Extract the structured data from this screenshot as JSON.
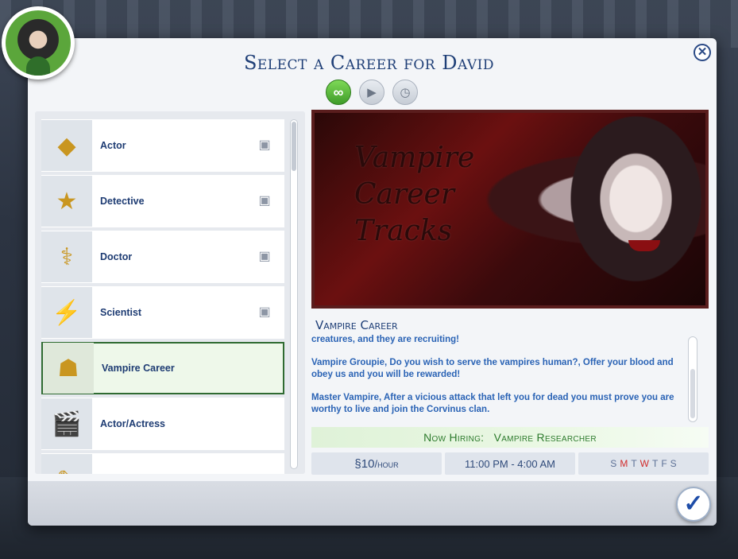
{
  "dialog": {
    "title": "Select a Career for David",
    "close_icon": "close-icon",
    "confirm_icon": "checkmark-icon"
  },
  "filters": [
    {
      "name": "all-careers",
      "glyph": "∞",
      "icon": "infinity-icon",
      "active": true
    },
    {
      "name": "full-time",
      "glyph": "▶",
      "icon": "briefcase-play-icon",
      "active": false
    },
    {
      "name": "part-time",
      "glyph": "◷",
      "icon": "briefcase-clock-icon",
      "active": false
    }
  ],
  "careers": [
    {
      "label": "Actor",
      "icon": "actor-badge-icon",
      "glyph": "◆",
      "type_glyph": "▣",
      "selected": false
    },
    {
      "label": "Detective",
      "icon": "police-badge-icon",
      "glyph": "★",
      "type_glyph": "▣",
      "selected": false
    },
    {
      "label": "Doctor",
      "icon": "caduceus-icon",
      "glyph": "⚕",
      "type_glyph": "▣",
      "selected": false
    },
    {
      "label": "Scientist",
      "icon": "tesla-coil-icon",
      "glyph": "⚡",
      "type_glyph": "▣",
      "selected": false
    },
    {
      "label": "Vampire Career",
      "icon": "vampire-portrait-icon",
      "glyph": "☗",
      "type_glyph": "",
      "selected": true
    },
    {
      "label": "Actor/Actress",
      "icon": "clapperboard-icon",
      "glyph": "🎬",
      "type_glyph": "",
      "selected": false
    },
    {
      "label": "",
      "icon": "career-icon",
      "glyph": "✎",
      "type_glyph": "",
      "selected": false
    }
  ],
  "detail": {
    "banner_text": [
      "Vampire",
      "Career",
      "Tracks"
    ],
    "career_name": "Vampire Career",
    "description": [
      "creatures, and they are recruiting!",
      "Vampire Groupie, Do you wish to serve the vampires human?, Offer your blood and obey us and you will be rewarded!",
      "Master Vampire, After a vicious attack that left you for dead you must prove you are worthy to live and join the Corvinus clan."
    ],
    "hiring_label": "Now Hiring:",
    "hiring_value": "Vampire Researcher",
    "pay_amount": "§10",
    "pay_unit": "/hour",
    "hours": "11:00 PM - 4:00 AM",
    "days": [
      {
        "d": "S",
        "work": false
      },
      {
        "d": "M",
        "work": true
      },
      {
        "d": "T",
        "work": false
      },
      {
        "d": "W",
        "work": true
      },
      {
        "d": "T",
        "work": false
      },
      {
        "d": "F",
        "work": false
      },
      {
        "d": "S",
        "work": false
      }
    ]
  },
  "colors": {
    "title": "#1f3f77",
    "hiring": "#2c7a2c",
    "work_day": "#d12b2b"
  }
}
